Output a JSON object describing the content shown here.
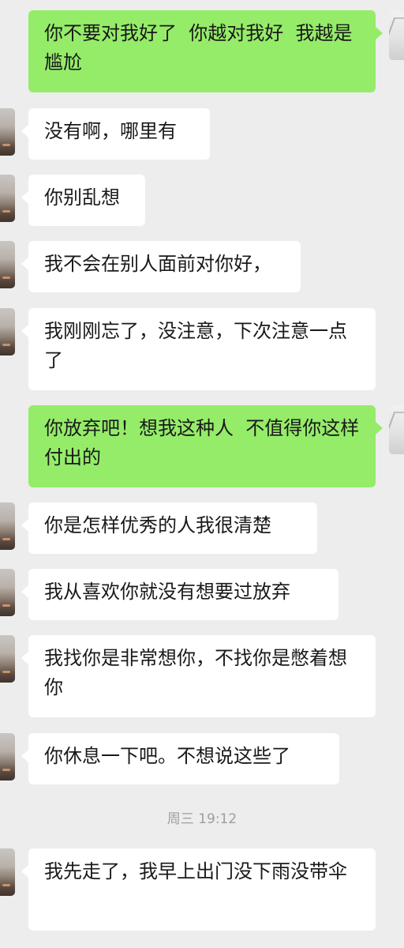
{
  "chat": {
    "messages": [
      {
        "side": "out",
        "text": "你不要对我好了  你越对我好  我越是尴尬"
      },
      {
        "side": "in",
        "text": "没有啊，哪里有"
      },
      {
        "side": "in",
        "text": "你别乱想"
      },
      {
        "side": "in",
        "text": "我不会在别人面前对你好，"
      },
      {
        "side": "in",
        "text": "我刚刚忘了，没注意，下次注意一点了"
      },
      {
        "side": "out",
        "text": "你放弃吧！想我这种人  不值得你这样付出的"
      },
      {
        "side": "in",
        "text": "你是怎样优秀的人我很清楚"
      },
      {
        "side": "in",
        "text": "我从喜欢你就没有想要过放弃"
      },
      {
        "side": "in",
        "text": "我找你是非常想你，不找你是憋着想你"
      },
      {
        "side": "in",
        "text": "你休息一下吧。不想说这些了"
      },
      {
        "side": "in",
        "text": "我先走了，我早上出门没下雨没带伞"
      }
    ],
    "timestamp": "周三 19:12"
  },
  "colors": {
    "background": "#ededed",
    "incoming_bubble": "#ffffff",
    "outgoing_bubble": "#95ec69",
    "timestamp_text": "#9e9e9e"
  }
}
